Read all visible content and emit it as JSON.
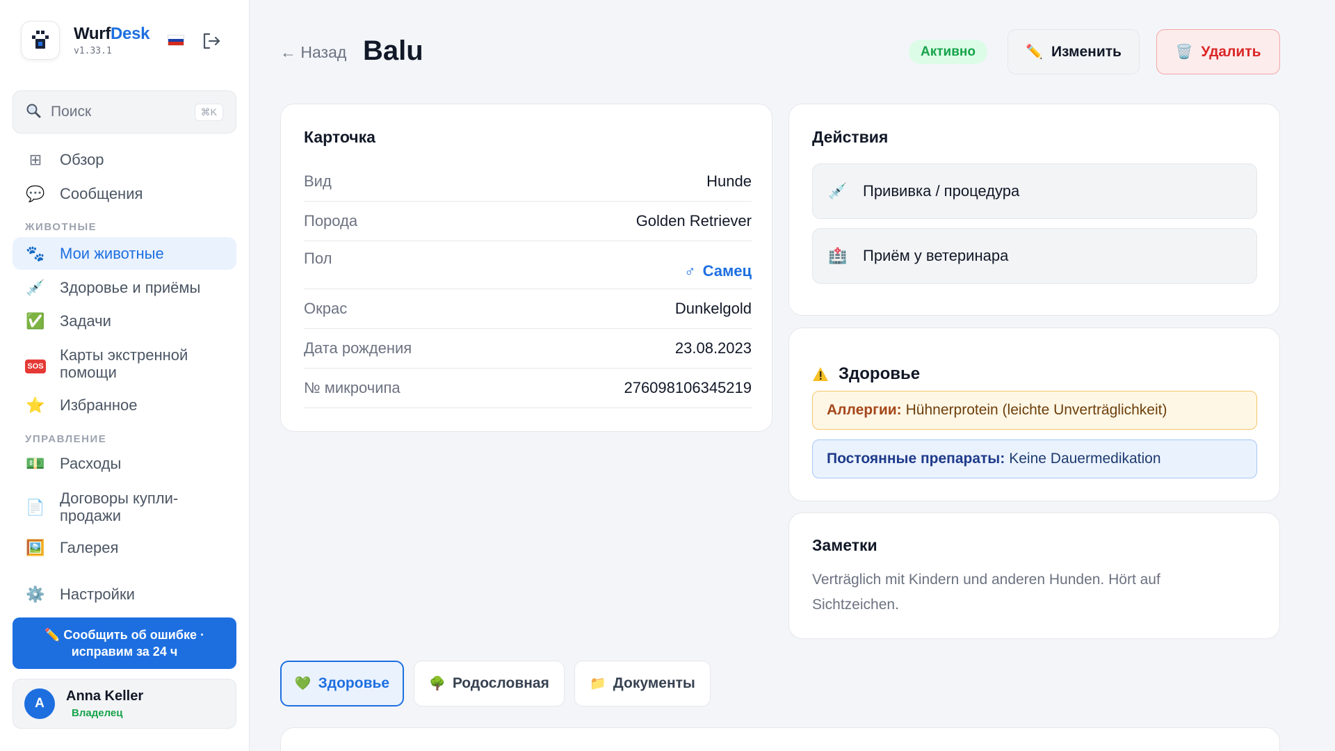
{
  "brand": {
    "name_prefix": "Wurf",
    "name_accent": "Desk",
    "version": "v1.33.1"
  },
  "colors": {
    "accent": "#1d6fe0",
    "success": "#16a34a",
    "danger": "#dc2626",
    "warning": "#f5c66b"
  },
  "search": {
    "placeholder": "Поиск",
    "shortcut": "⌘K"
  },
  "sidebar": {
    "top_items": [
      {
        "label": "Обзор",
        "icon": "grid-icon"
      },
      {
        "label": "Сообщения",
        "icon": "speech-bubble-icon"
      }
    ],
    "section_animals": "ЖИВОТНЫЕ",
    "animal_items": [
      {
        "label": "Мои животные",
        "icon": "paw-prints-icon",
        "active": true
      },
      {
        "label": "Здоровье и приёмы",
        "icon": "syringe-icon"
      },
      {
        "label": "Задачи",
        "icon": "check-mark-icon"
      },
      {
        "label": "Карты экстренной помощи",
        "icon": "sos-icon"
      },
      {
        "label": "Избранное",
        "icon": "star-icon"
      }
    ],
    "section_manage": "УПРАВЛЕНИЕ",
    "manage_items": [
      {
        "label": "Расходы",
        "icon": "banknote-icon"
      },
      {
        "label": "Договоры купли-продажи",
        "icon": "document-icon"
      },
      {
        "label": "Галерея",
        "icon": "picture-icon"
      }
    ],
    "settings": {
      "label": "Настройки",
      "icon": "gear-icon"
    },
    "report_button": "✏️ Сообщить об ошибке · исправим за 24 ч",
    "user": {
      "initial": "A",
      "name": "Anna Keller",
      "role": "Владелец"
    }
  },
  "header": {
    "back_label": "← Назад",
    "title": "Balu",
    "status": "Активно",
    "edit_label": "Изменить",
    "delete_label": "Удалить"
  },
  "profile": {
    "title": "Карточка",
    "rows": [
      {
        "key": "Вид",
        "value": "Hunde"
      },
      {
        "key": "Порода",
        "value": "Golden Retriever"
      },
      {
        "key": "Пол",
        "value": "Самец",
        "symbol": "♂"
      },
      {
        "key": "Окрас",
        "value": "Dunkelgold"
      },
      {
        "key": "Дата рождения",
        "value": "23.08.2023"
      },
      {
        "key": "№ микрочипа",
        "value": "276098106345219"
      }
    ]
  },
  "actions": {
    "title": "Действия",
    "items": [
      {
        "label": "Прививка / процедура",
        "icon": "syringe-icon"
      },
      {
        "label": "Приём у ветеринара",
        "icon": "hospital-icon"
      }
    ]
  },
  "health": {
    "title": "Здоровье",
    "allergy_label": "Аллергии:",
    "allergy_value": "Hühnerprotein (leichte Unverträglichkeit)",
    "meds_label": "Постоянные препараты:",
    "meds_value": "Keine Dauermedikation"
  },
  "notes": {
    "title": "Заметки",
    "text": "Verträglich mit Kindern und anderen Hunden. Hört auf Sichtzeichen."
  },
  "tabs": [
    {
      "label": "Здоровье",
      "icon": "green-heart-icon",
      "active": true
    },
    {
      "label": "Родословная",
      "icon": "tree-icon"
    },
    {
      "label": "Документы",
      "icon": "folder-icon"
    }
  ]
}
